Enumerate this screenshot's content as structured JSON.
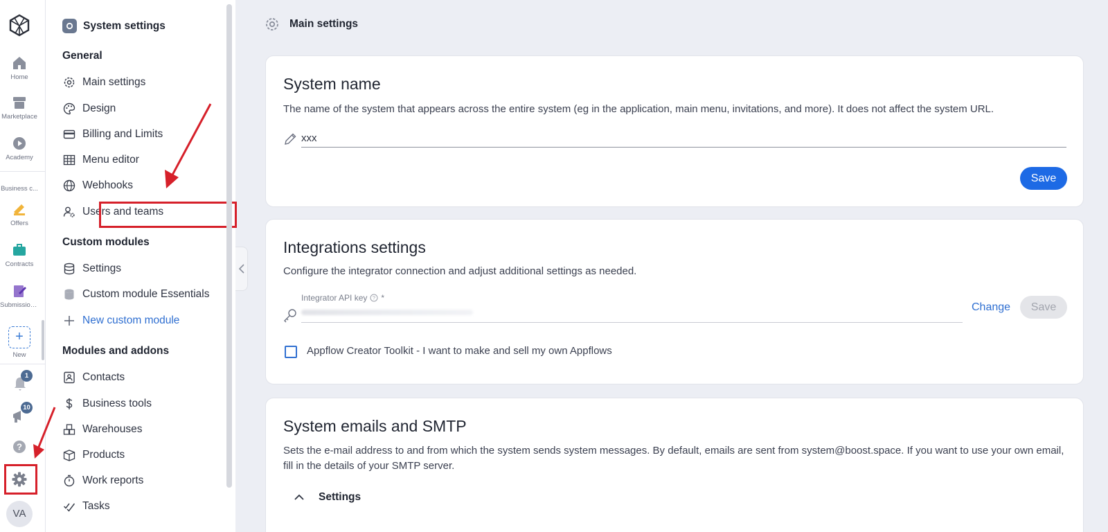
{
  "rail": {
    "items": [
      {
        "label": "Home",
        "icon": "home-icon"
      },
      {
        "label": "Marketplace",
        "icon": "store-icon"
      },
      {
        "label": "Academy",
        "icon": "play-icon"
      },
      {
        "label": "Business c...",
        "icon": ""
      },
      {
        "label": "Offers",
        "icon": "offers-icon"
      },
      {
        "label": "Contracts",
        "icon": "briefcase-icon"
      },
      {
        "label": "Submission...",
        "icon": "edit-doc-icon"
      },
      {
        "label": "New",
        "icon": "plus-icon"
      }
    ],
    "notifications_count": "1",
    "announcements_count": "10",
    "avatar_initials": "VA"
  },
  "panel": {
    "title": "System settings",
    "sections": {
      "general": "General",
      "custom_modules": "Custom modules",
      "modules_addons": "Modules and addons"
    },
    "general_items": [
      "Main settings",
      "Design",
      "Billing and Limits",
      "Menu editor",
      "Webhooks",
      "Users and teams"
    ],
    "custom_items": [
      "Settings",
      "Custom module Essentials",
      "New custom module"
    ],
    "addon_items": [
      "Contacts",
      "Business tools",
      "Warehouses",
      "Products",
      "Work reports",
      "Tasks"
    ]
  },
  "main": {
    "title": "Main settings",
    "system_name": {
      "heading": "System name",
      "description": "The name of the system that appears across the entire system (eg in the application, main menu, invitations, and more). It does not affect the system URL.",
      "value": "xxx",
      "save_label": "Save"
    },
    "integrations": {
      "heading": "Integrations settings",
      "description": "Configure the integrator connection and adjust additional settings as needed.",
      "api_key_label": "Integrator API key",
      "required_mark": "*",
      "change_label": "Change",
      "save_label": "Save",
      "checkbox_label": "Appflow Creator Toolkit - I want to make and sell my own Appflows"
    },
    "emails": {
      "heading": "System emails and SMTP",
      "description": "Sets the e-mail address to and from which the system sends system messages. By default, emails are sent from system@boost.space. If you want to use your own email, fill in the details of your SMTP server.",
      "settings_label": "Settings"
    }
  },
  "colors": {
    "accent": "#1d6ae5",
    "highlight": "#d6202a"
  }
}
